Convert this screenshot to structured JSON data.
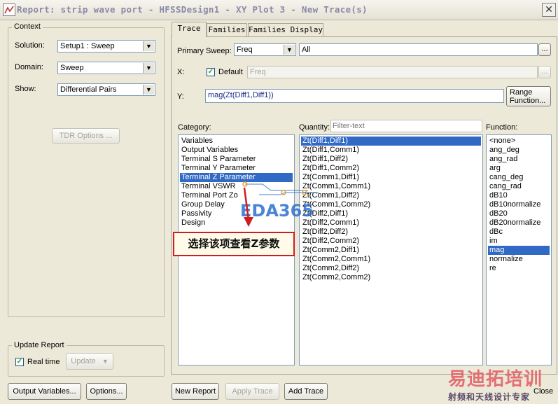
{
  "window": {
    "title": "Report: strip wave port - HFSSDesign1 - XY Plot 3 - New Trace(s)",
    "close_glyph": "✕"
  },
  "context": {
    "group_title": "Context",
    "solution_label": "Solution:",
    "solution_value": "Setup1 : Sweep",
    "domain_label": "Domain:",
    "domain_value": "Sweep",
    "show_label": "Show:",
    "show_value": "Differential Pairs",
    "tdr_button": "TDR Options ..."
  },
  "update_report": {
    "group_title": "Update Report",
    "realtime_label": "Real time",
    "realtime_checked": true,
    "update_button": "Update"
  },
  "bottom_buttons": {
    "output_variables": "Output Variables...",
    "options": "Options...",
    "new_report": "New Report",
    "apply_trace": "Apply Trace",
    "add_trace": "Add Trace",
    "close": "Close"
  },
  "tabs": [
    "Trace",
    "Families",
    "Families Display"
  ],
  "trace": {
    "primary_sweep_label": "Primary Sweep:",
    "primary_sweep_value": "Freq",
    "range_value": "All",
    "ellipsis": "...",
    "x_label": "X:",
    "default_label": "Default",
    "default_checked": true,
    "x_value": "Freq",
    "y_label": "Y:",
    "y_value": "mag(Zt(Diff1,Diff1))",
    "range_function_button": [
      "Range",
      "Function..."
    ]
  },
  "category": {
    "label": "Category:",
    "items": [
      "Variables",
      "Output Variables",
      "Terminal S Parameter",
      "Terminal Y Parameter",
      "Terminal Z Parameter",
      "Terminal VSWR",
      "Terminal Port Zo",
      "Group Delay",
      "Passivity",
      "Design"
    ],
    "selected_index": 4
  },
  "quantity": {
    "label": "Quantity:",
    "filter_placeholder": "Filter-text",
    "items": [
      "Zt(Diff1,Diff1)",
      "Zt(Diff1,Comm1)",
      "Zt(Diff1,Diff2)",
      "Zt(Diff1,Comm2)",
      "Zt(Comm1,Diff1)",
      "Zt(Comm1,Comm1)",
      "Zt(Comm1,Diff2)",
      "Zt(Comm1,Comm2)",
      "Zt(Diff2,Diff1)",
      "Zt(Diff2,Comm1)",
      "Zt(Diff2,Diff2)",
      "Zt(Diff2,Comm2)",
      "Zt(Comm2,Diff1)",
      "Zt(Comm2,Comm1)",
      "Zt(Comm2,Diff2)",
      "Zt(Comm2,Comm2)"
    ],
    "selected_index": 0
  },
  "function": {
    "label": "Function:",
    "items": [
      "<none>",
      "ang_deg",
      "ang_rad",
      "arg",
      "cang_deg",
      "cang_rad",
      "dB10",
      "dB10normalize",
      "dB20",
      "dB20normalize",
      "dBc",
      "im",
      "mag",
      "normalize",
      "re"
    ],
    "selected_index": 12
  },
  "annotation": {
    "text": "选择该项查看Z参数"
  },
  "watermarks": {
    "eda": "EDA365",
    "cn_brand": "易迪拓培训",
    "cn_sub": "射频和天线设计专家"
  }
}
